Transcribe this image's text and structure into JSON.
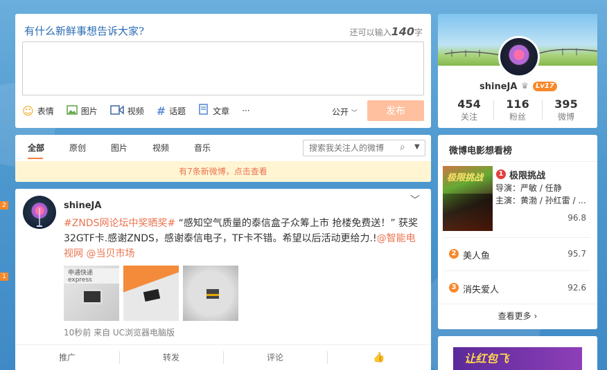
{
  "publish": {
    "title": "有什么新鲜事想告诉大家?",
    "count_prefix": "还可以输入",
    "count_num": "140",
    "count_suffix": "字",
    "tools": [
      {
        "label": "表情",
        "icon": "emoji-icon"
      },
      {
        "label": "图片",
        "icon": "image-icon"
      },
      {
        "label": "视频",
        "icon": "video-icon"
      },
      {
        "label": "话题",
        "icon": "hashtag-icon"
      },
      {
        "label": "文章",
        "icon": "article-icon"
      }
    ],
    "more": "···",
    "scope": "公开",
    "submit": "发布"
  },
  "tabs": {
    "items": [
      "全部",
      "原创",
      "图片",
      "视频",
      "音乐"
    ],
    "search_placeholder": "搜索我关注人的微博",
    "notice": "有7条新微博，点击查看"
  },
  "feed": {
    "name": "shineJA",
    "topic": "#ZNDS网论坛中奖晒奖#",
    "text": " “感知空气质量的泰信盒子众筹上市 抢楼免费送！” 获奖32GTF卡.感谢ZNDS，感谢泰信电子，TF卡不错。希望以后活动更给力.!",
    "mention1": "@智能电视网",
    "mention2": "@当贝市场",
    "thumb1_text": "申通快递 express",
    "source": "10秒前 来自 UC浏览器电脑版",
    "actions": [
      "推广",
      "转发",
      "评论",
      ""
    ]
  },
  "profile": {
    "name": "shineJA",
    "level": "Lv17",
    "stats": [
      {
        "num": "454",
        "label": "关注"
      },
      {
        "num": "116",
        "label": "粉丝"
      },
      {
        "num": "395",
        "label": "微博"
      }
    ]
  },
  "movies": {
    "title": "微博电影想看榜",
    "first": {
      "rank": "1",
      "name": "极限挑战",
      "director": "导演：严敏 / 任静",
      "actors": "主演：黄渤 / 孙红雷 / ...",
      "score": "96.8",
      "poster_text": "极限挑战"
    },
    "rows": [
      {
        "rank": "2",
        "name": "美人鱼",
        "score": "95.7"
      },
      {
        "rank": "3",
        "name": "消失爱人",
        "score": "92.6"
      }
    ],
    "more": "查看更多"
  },
  "ad": {
    "text": "让红包飞"
  },
  "side_markers": [
    "2",
    "1"
  ]
}
